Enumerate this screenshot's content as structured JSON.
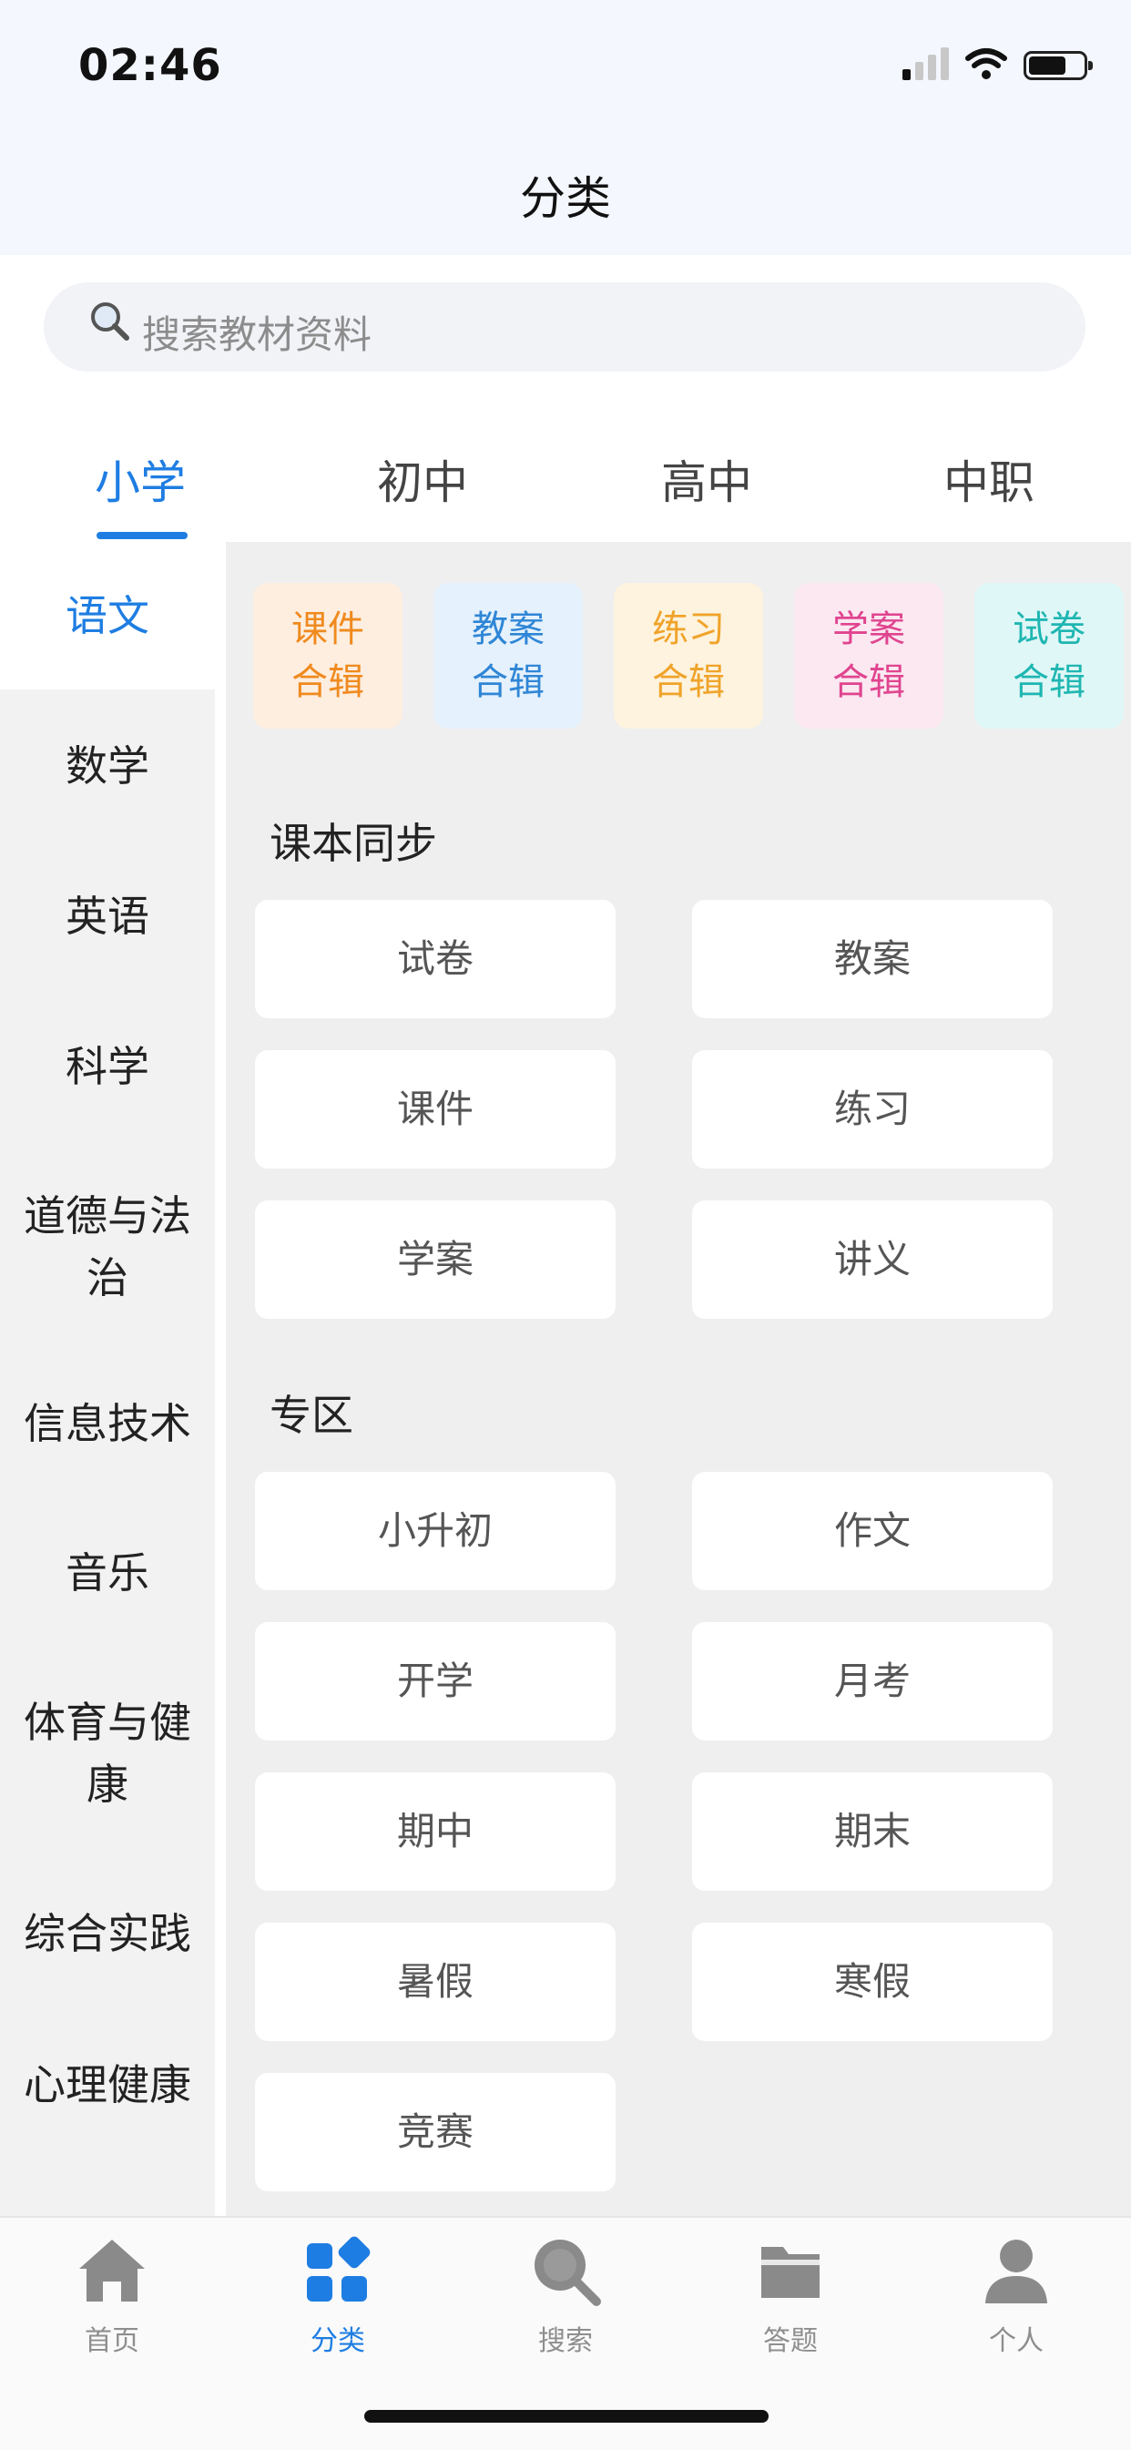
{
  "status": {
    "time": "02:46"
  },
  "header": {
    "title": "分类"
  },
  "search": {
    "placeholder": "搜索教材资料"
  },
  "levels": [
    "小学",
    "初中",
    "高中",
    "中职"
  ],
  "subjects": [
    "语文",
    "数学",
    "英语",
    "科学",
    "道德与法治",
    "信息技术",
    "音乐",
    "体育与健康",
    "综合实践",
    "心理健康"
  ],
  "collections": [
    {
      "label": "课件合辑",
      "color": "#f08a1e",
      "bg": "#fdeee0"
    },
    {
      "label": "教案合辑",
      "color": "#2f86d6",
      "bg": "#e5f1fc"
    },
    {
      "label": "练习合辑",
      "color": "#f0a32a",
      "bg": "#fdf3de"
    },
    {
      "label": "学案合辑",
      "color": "#e0448f",
      "bg": "#fbe8f1"
    },
    {
      "label": "试卷合辑",
      "color": "#1fb6b2",
      "bg": "#dff7f6"
    }
  ],
  "sync_section": {
    "title": "课本同步",
    "items": [
      "试卷",
      "教案",
      "课件",
      "练习",
      "学案",
      "讲义"
    ]
  },
  "special_section": {
    "title": "专区",
    "items": [
      "小升初",
      "作文",
      "开学",
      "月考",
      "期中",
      "期末",
      "暑假",
      "寒假",
      "竞赛"
    ]
  },
  "tabbar": [
    {
      "label": "首页",
      "icon": "home-icon"
    },
    {
      "label": "分类",
      "icon": "category-icon"
    },
    {
      "label": "搜索",
      "icon": "search-icon"
    },
    {
      "label": "答题",
      "icon": "folder-icon"
    },
    {
      "label": "个人",
      "icon": "user-icon"
    }
  ],
  "colors": {
    "accent": "#1e7de2"
  }
}
